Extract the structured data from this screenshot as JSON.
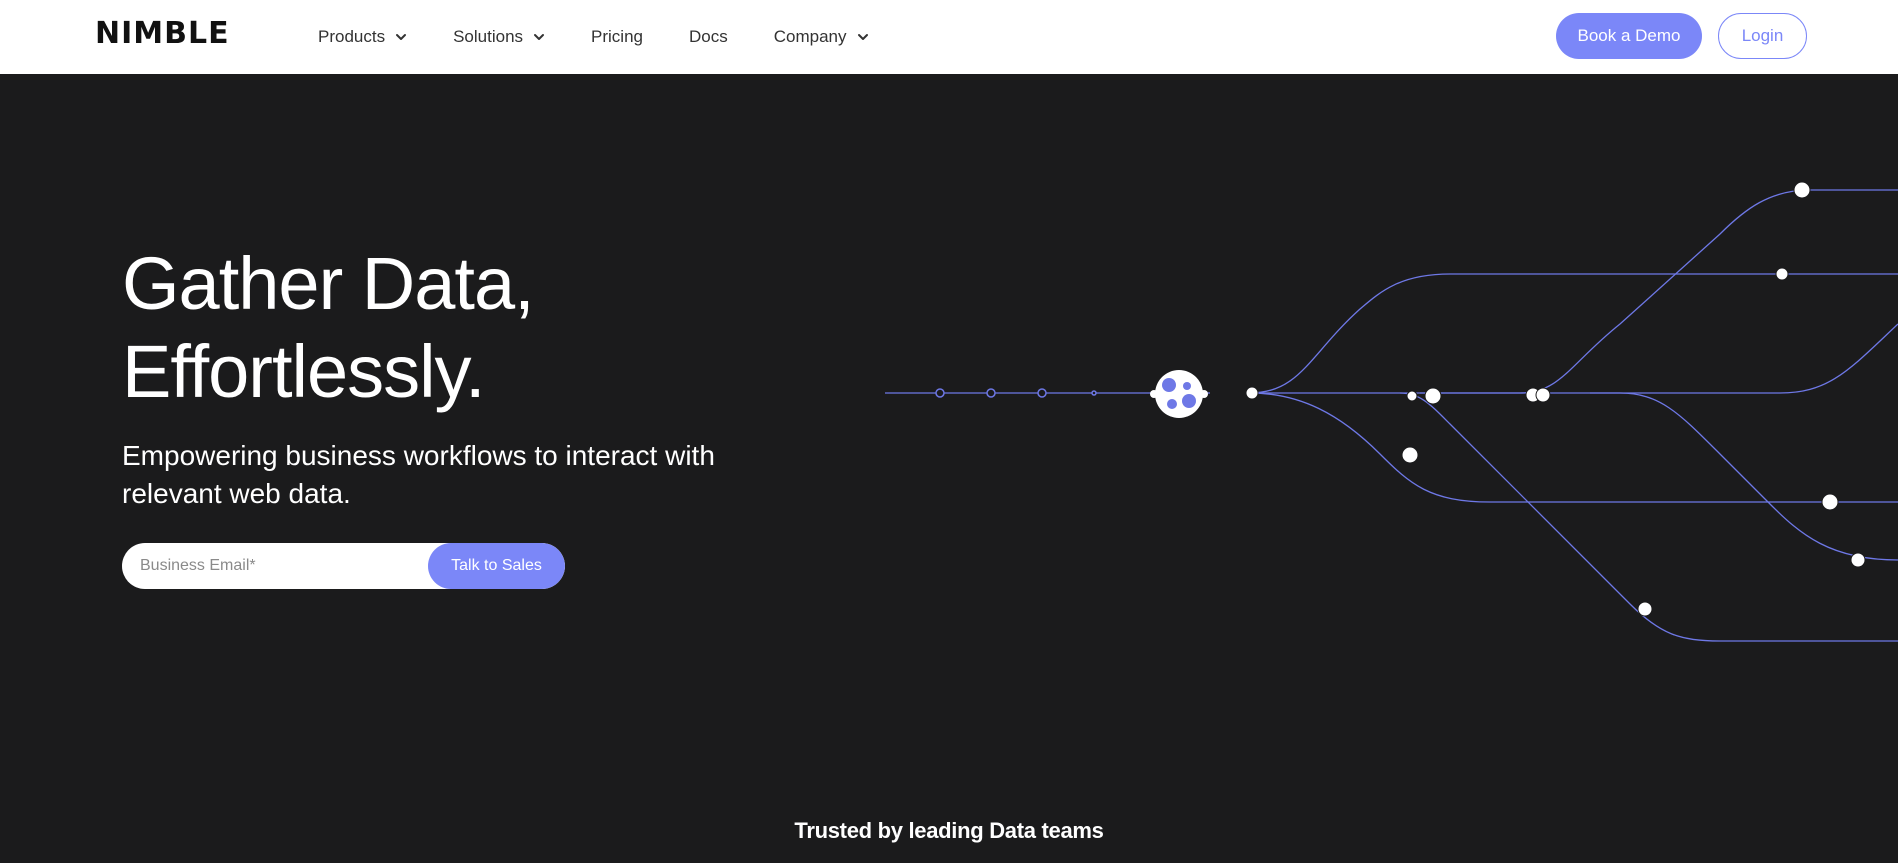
{
  "brand": {
    "logo_text": "NIMBLE"
  },
  "nav": {
    "items": [
      {
        "label": "Products",
        "has_dropdown": true
      },
      {
        "label": "Solutions",
        "has_dropdown": true
      },
      {
        "label": "Pricing",
        "has_dropdown": false
      },
      {
        "label": "Docs",
        "has_dropdown": false
      },
      {
        "label": "Company",
        "has_dropdown": true
      }
    ],
    "demo_label": "Book a Demo",
    "login_label": "Login"
  },
  "hero": {
    "title_line1": "Gather Data,",
    "title_line2": "Effortlessly.",
    "subtitle": "Empowering business workflows to interact with relevant web data.",
    "email_placeholder": "Business Email*",
    "email_value": "",
    "cta_label": "Talk to Sales"
  },
  "trusted": {
    "label": "Trusted by leading Data teams"
  },
  "colors": {
    "accent": "#7b87f8",
    "background_dark": "#1b1b1c",
    "navbar_bg": "#ffffff",
    "line_color": "#6e78e6"
  },
  "icons": {
    "chevron": "chevron-down-icon",
    "hub": "nimble-hub-icon"
  }
}
